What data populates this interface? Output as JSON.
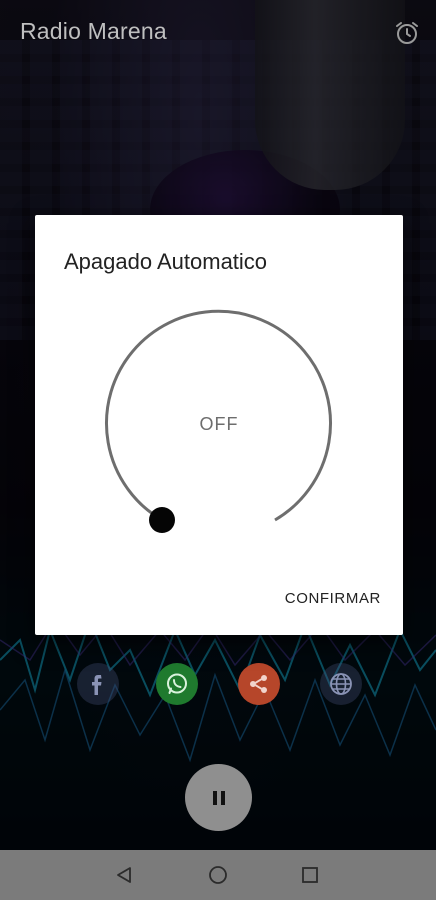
{
  "app": {
    "title": "Radio Marena",
    "alarm_icon": "alarm-clock-icon"
  },
  "dialog": {
    "title": "Apagado Automatico",
    "timer_value": "OFF",
    "confirm_label": "CONFIRMAR"
  },
  "social": {
    "facebook_icon": "facebook-icon",
    "whatsapp_icon": "whatsapp-icon",
    "share_icon": "share-icon",
    "web_icon": "globe-icon"
  },
  "player": {
    "state_icon": "pause-icon"
  },
  "system_nav": {
    "back": "back-icon",
    "home": "home-icon",
    "recents": "recents-icon"
  },
  "colors": {
    "whatsapp": "#1f7a2e",
    "share": "#b6462a",
    "dialog_bg": "#ffffff",
    "nav_bar": "#7b7b7b"
  }
}
